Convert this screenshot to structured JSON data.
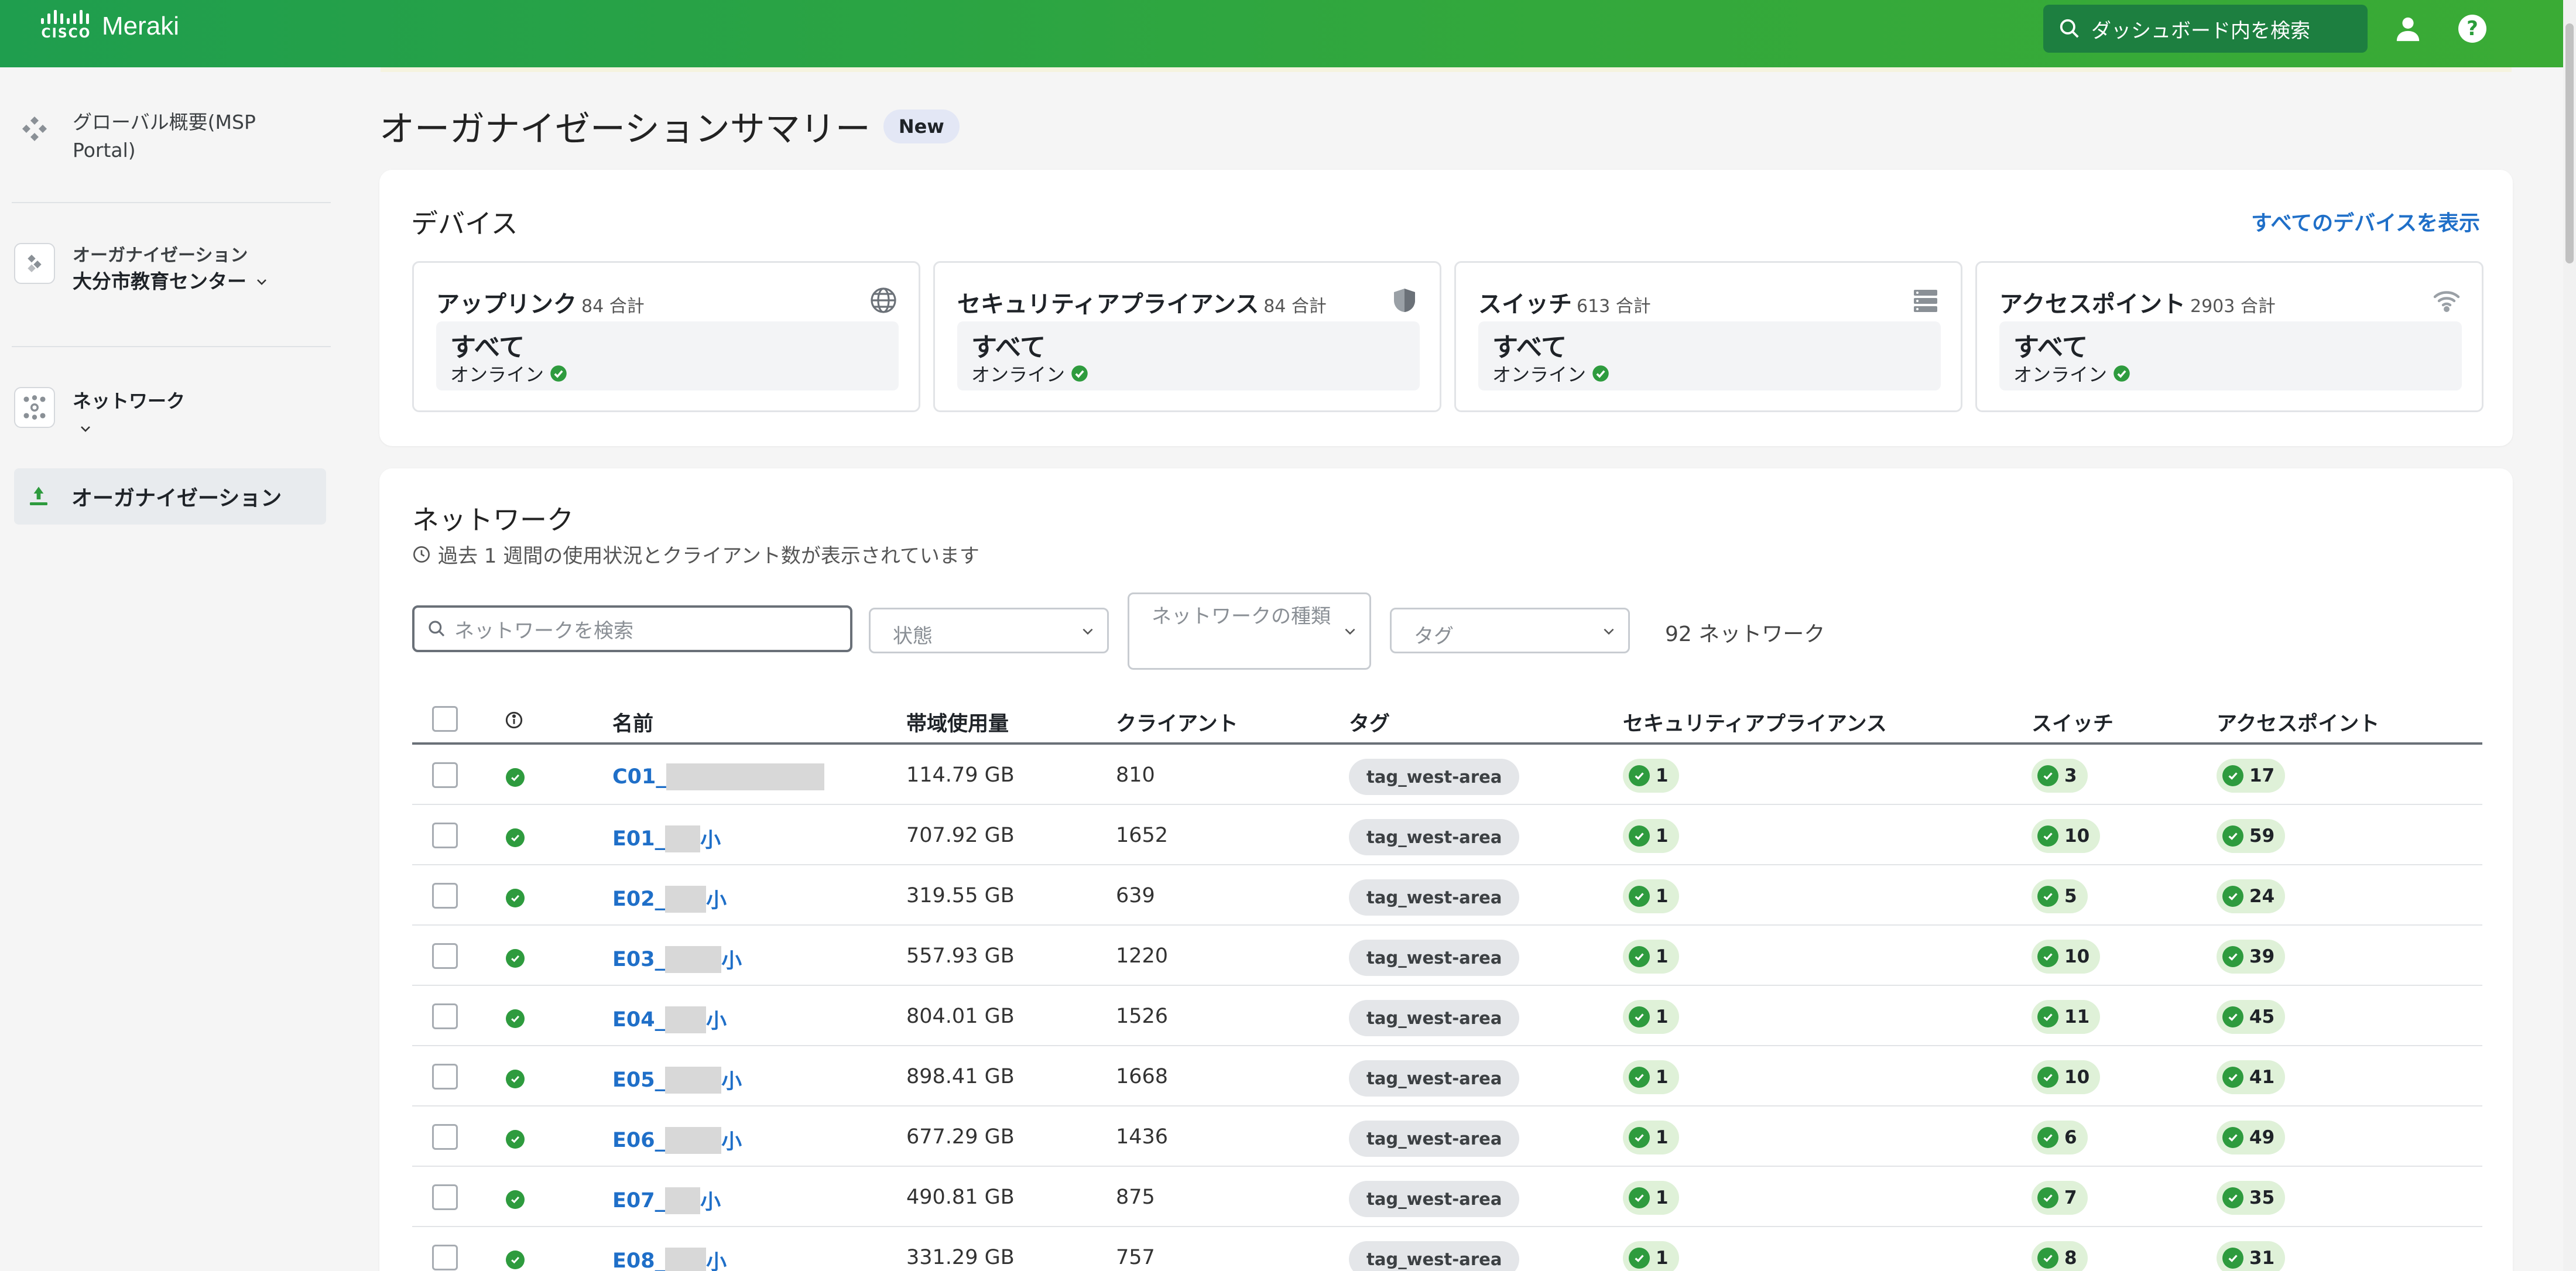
{
  "topbar": {
    "cisco_text": "CISCO",
    "brand": "Meraki",
    "search_placeholder": "ダッシュボード内を検索",
    "help_glyph": "?",
    "colors": {
      "bar": "#2ea443",
      "search_bg": "#1d7f40"
    },
    "icons": [
      "cisco-logo-icon",
      "search-icon",
      "user-icon",
      "help-icon"
    ]
  },
  "sidebar": {
    "global": {
      "line1": "グローバル概要(MSP",
      "line2": "Portal)"
    },
    "org": {
      "label": "オーガナイゼーション",
      "name": "大分市教育センター"
    },
    "network": {
      "label": "ネットワーク"
    },
    "active": {
      "label": "オーガナイゼーション"
    }
  },
  "page": {
    "title": "オーガナイゼーションサマリー",
    "badge": "New"
  },
  "devices": {
    "title": "デバイス",
    "view_all": "すべてのデバイスを表示",
    "tiles": [
      {
        "name": "アップリンク",
        "count": "84 合計",
        "status": "すべて",
        "online": "オンライン",
        "icon": "globe-icon"
      },
      {
        "name": "セキュリティアプライアンス",
        "count": "84 合計",
        "status": "すべて",
        "online": "オンライン",
        "icon": "shield-icon"
      },
      {
        "name": "スイッチ",
        "count": "613 合計",
        "status": "すべて",
        "online": "オンライン",
        "icon": "switch-icon"
      },
      {
        "name": "アクセスポイント",
        "count": "2903 合計",
        "status": "すべて",
        "online": "オンライン",
        "icon": "wifi-icon"
      }
    ]
  },
  "networks": {
    "title": "ネットワーク",
    "subtitle": "過去 1 週間の使用状況とクライアント数が表示されています",
    "search_placeholder": "ネットワークを検索",
    "filters": {
      "status": "状態",
      "type": "ネットワークの種類",
      "tag": "タグ"
    },
    "count": "92 ネットワーク",
    "columns": {
      "info": "ⓘ",
      "name": "名前",
      "bandwidth": "帯域使用量",
      "clients": "クライアント",
      "tag": "タグ",
      "security": "セキュリティアプライアンス",
      "switch": "スイッチ",
      "ap": "アクセスポイント"
    },
    "rows": [
      {
        "prefix": "C01_",
        "suffix": "",
        "bandwidth": "114.79 GB",
        "clients": "810",
        "tag": "tag_west-area",
        "security": "1",
        "switch": "3",
        "ap": "17"
      },
      {
        "prefix": "E01_",
        "suffix": "小",
        "bandwidth": "707.92 GB",
        "clients": "1652",
        "tag": "tag_west-area",
        "security": "1",
        "switch": "10",
        "ap": "59"
      },
      {
        "prefix": "E02_",
        "suffix": "小",
        "bandwidth": "319.55 GB",
        "clients": "639",
        "tag": "tag_west-area",
        "security": "1",
        "switch": "5",
        "ap": "24"
      },
      {
        "prefix": "E03_",
        "suffix": "小",
        "bandwidth": "557.93 GB",
        "clients": "1220",
        "tag": "tag_west-area",
        "security": "1",
        "switch": "10",
        "ap": "39"
      },
      {
        "prefix": "E04_",
        "suffix": "小",
        "bandwidth": "804.01 GB",
        "clients": "1526",
        "tag": "tag_west-area",
        "security": "1",
        "switch": "11",
        "ap": "45"
      },
      {
        "prefix": "E05_",
        "suffix": "小",
        "bandwidth": "898.41 GB",
        "clients": "1668",
        "tag": "tag_west-area",
        "security": "1",
        "switch": "10",
        "ap": "41"
      },
      {
        "prefix": "E06_",
        "suffix": "小",
        "bandwidth": "677.29 GB",
        "clients": "1436",
        "tag": "tag_west-area",
        "security": "1",
        "switch": "6",
        "ap": "49"
      },
      {
        "prefix": "E07_",
        "suffix": "小",
        "bandwidth": "490.81 GB",
        "clients": "875",
        "tag": "tag_west-area",
        "security": "1",
        "switch": "7",
        "ap": "35"
      },
      {
        "prefix": "E08_",
        "suffix": "小",
        "bandwidth": "331.29 GB",
        "clients": "757",
        "tag": "tag_west-area",
        "security": "1",
        "switch": "8",
        "ap": "31"
      }
    ]
  }
}
